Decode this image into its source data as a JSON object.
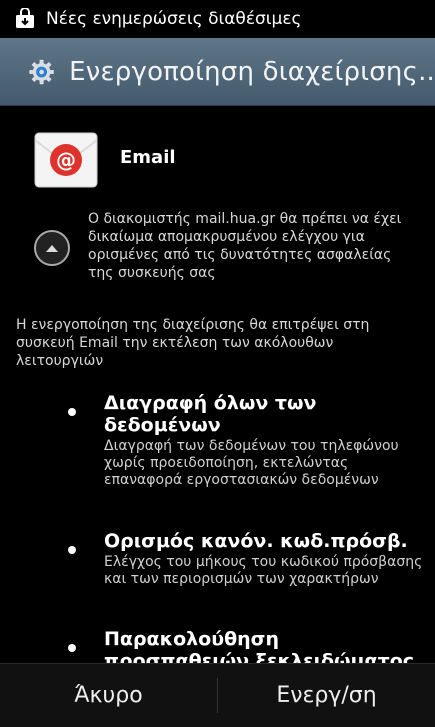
{
  "status_bar": {
    "notification_text": "Νέες ενημερώσεις διαθέσιμες",
    "icon": "update-bag-icon"
  },
  "title_bar": {
    "title": "Ενεργοποίηση διαχείρισης..",
    "icon": "settings-gear-icon"
  },
  "app": {
    "name": "Email",
    "icon": "email-app-icon",
    "accent_color": "#e0322c"
  },
  "server_notice": {
    "text": "Ο διακομιστής mail.hua.gr θα πρέπει να έχει δικαίωμα απομακρυσμένου ελέγχου για ορισμένες από τις δυνατότητες ασφαλείας της συσκευής σας",
    "collapse_icon": "chevron-up-icon"
  },
  "intro": {
    "text": "Η ενεργοποίηση της διαχείρισης θα επιτρέψει στη συσκευή Email την εκτέλεση των ακόλουθων λειτουργιών"
  },
  "policies": [
    {
      "title": "Διαγραφή όλων των δεδομένων",
      "description": "Διαγραφή των δεδομένων του τηλεφώνου χωρίς προειδοποίηση, εκτελώντας επαναφορά εργοστασιακών δεδομένων"
    },
    {
      "title": "Ορισμός κανόν. κωδ.πρόσβ.",
      "description": "Ελέγχος του μήκους του κωδικού πρόσβασης και των περιορισμών των χαρακτήρων"
    },
    {
      "title": "Παρακολούθηση προσπαθειών ξεκλειδώματος οθόνης",
      "description": ""
    }
  ],
  "bottom_bar": {
    "cancel_label": "Άκυρο",
    "activate_label": "Ενεργ/ση"
  }
}
